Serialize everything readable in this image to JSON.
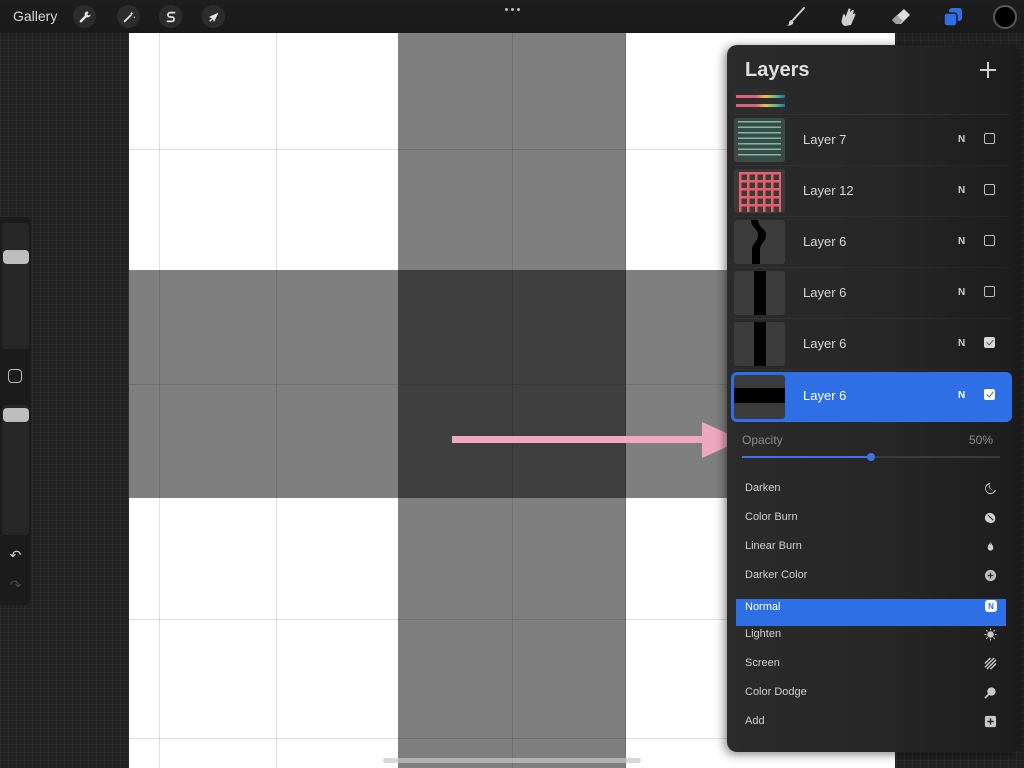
{
  "toolbar": {
    "gallery_label": "Gallery",
    "left_tools": [
      {
        "name": "actions",
        "icon": "wrench-icon"
      },
      {
        "name": "adjustments",
        "icon": "magic-wand-icon"
      },
      {
        "name": "selection",
        "icon": "selection-s-icon"
      },
      {
        "name": "transform",
        "icon": "arrow-cursor-icon"
      }
    ],
    "more_menu_icon": "ellipsis-icon",
    "right_tools": [
      {
        "name": "paint",
        "icon": "brush-icon",
        "active": false
      },
      {
        "name": "smudge",
        "icon": "smudge-finger-icon",
        "active": false
      },
      {
        "name": "erase",
        "icon": "eraser-icon",
        "active": false
      },
      {
        "name": "layers",
        "icon": "layers-icon",
        "active": true
      }
    ],
    "current_color": "#000000"
  },
  "sidebar": {
    "brush_size_icon": "brush-size-slider",
    "modify_icon": "square-modify-icon",
    "opacity_icon": "brush-opacity-slider",
    "undo_icon": "undo-arrow-icon",
    "redo_icon": "redo-arrow-icon"
  },
  "annotation": {
    "arrow_color": "#f0a8c0",
    "points_to": "Opacity"
  },
  "layers_panel": {
    "title": "Layers",
    "add_icon": "plus-icon",
    "layers": [
      {
        "name": "",
        "blend": "",
        "visible": null,
        "thumb": "rainbow-stripes",
        "partial": true
      },
      {
        "name": "Layer 7",
        "blend": "N",
        "visible": false,
        "thumb": "green-lines"
      },
      {
        "name": "Layer 12",
        "blend": "N",
        "visible": false,
        "thumb": "red-grid"
      },
      {
        "name": "Layer 6",
        "blend": "N",
        "visible": false,
        "thumb": "wavy-vertical-bar"
      },
      {
        "name": "Layer 6",
        "blend": "N",
        "visible": false,
        "thumb": "vertical-bar"
      },
      {
        "name": "Layer 6",
        "blend": "N",
        "visible": true,
        "thumb": "vertical-bar"
      },
      {
        "name": "Layer 6",
        "blend": "N",
        "visible": true,
        "thumb": "horizontal-bar",
        "selected": true
      }
    ],
    "opacity": {
      "label": "Opacity",
      "value_text": "50%",
      "value": 0.5
    },
    "blend_modes": [
      {
        "label": "Darken",
        "icon": "moon-icon"
      },
      {
        "label": "Color Burn",
        "icon": "burn-leaf-icon"
      },
      {
        "label": "Linear Burn",
        "icon": "flame-icon"
      },
      {
        "label": "Darker Color",
        "icon": "plus-circle-icon"
      },
      {
        "label": "Normal",
        "icon": "n-badge-icon",
        "badge": "N",
        "selected": true
      },
      {
        "label": "Lighten",
        "icon": "sun-icon"
      },
      {
        "label": "Screen",
        "icon": "diagonal-stripes-icon"
      },
      {
        "label": "Color Dodge",
        "icon": "magnifier-icon"
      },
      {
        "label": "Add",
        "icon": "plus-square-icon"
      }
    ]
  },
  "colors": {
    "accent": "#2f6fe6",
    "canvas_bg": "#ffffff",
    "panel_bg": "#262626"
  }
}
